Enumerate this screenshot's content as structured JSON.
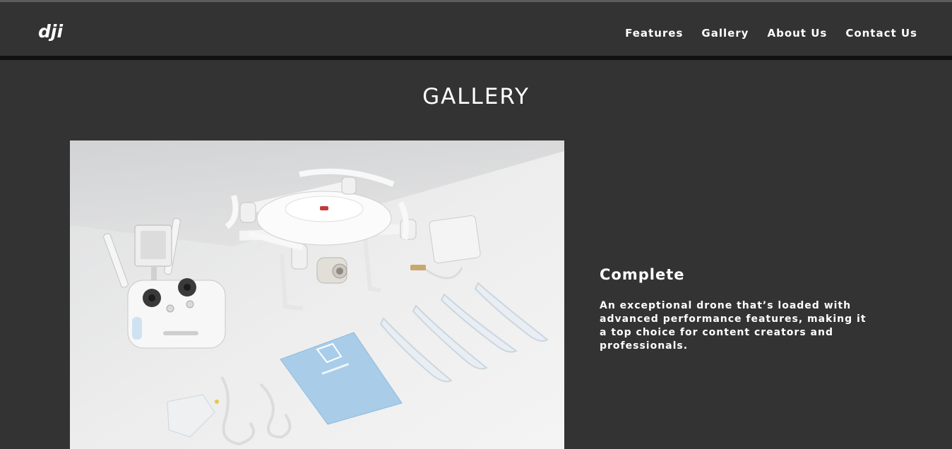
{
  "header": {
    "logo_text": "dji",
    "nav": [
      {
        "label": "Features"
      },
      {
        "label": "Gallery"
      },
      {
        "label": "About Us"
      },
      {
        "label": "Contact Us"
      }
    ]
  },
  "gallery": {
    "title": "GALLERY",
    "item": {
      "image_name": "drone-kit-photo",
      "heading": "Complete",
      "description": "An exceptional drone that’s loaded with advanced performance features, making it a top choice for content creators and professionals."
    }
  },
  "colors": {
    "background": "#333333",
    "text": "#ffffff",
    "divider": "#111111",
    "manual_blue": "#a9cde9"
  }
}
